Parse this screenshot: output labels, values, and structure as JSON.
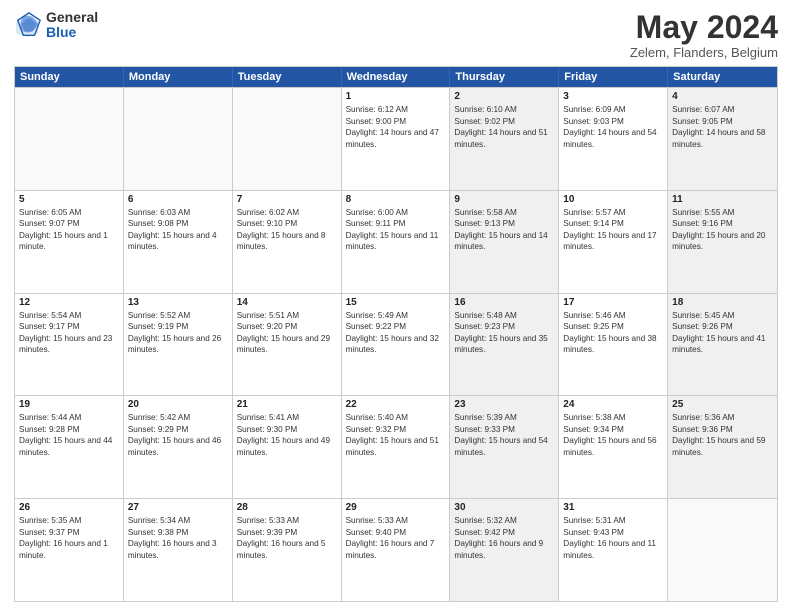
{
  "logo": {
    "general": "General",
    "blue": "Blue"
  },
  "title": "May 2024",
  "subtitle": "Zelem, Flanders, Belgium",
  "days": [
    "Sunday",
    "Monday",
    "Tuesday",
    "Wednesday",
    "Thursday",
    "Friday",
    "Saturday"
  ],
  "weeks": [
    [
      {
        "day": "",
        "sunrise": "",
        "sunset": "",
        "daylight": "",
        "shaded": false,
        "empty": true
      },
      {
        "day": "",
        "sunrise": "",
        "sunset": "",
        "daylight": "",
        "shaded": false,
        "empty": true
      },
      {
        "day": "",
        "sunrise": "",
        "sunset": "",
        "daylight": "",
        "shaded": false,
        "empty": true
      },
      {
        "day": "1",
        "sunrise": "Sunrise: 6:12 AM",
        "sunset": "Sunset: 9:00 PM",
        "daylight": "Daylight: 14 hours and 47 minutes.",
        "shaded": false,
        "empty": false
      },
      {
        "day": "2",
        "sunrise": "Sunrise: 6:10 AM",
        "sunset": "Sunset: 9:02 PM",
        "daylight": "Daylight: 14 hours and 51 minutes.",
        "shaded": true,
        "empty": false
      },
      {
        "day": "3",
        "sunrise": "Sunrise: 6:09 AM",
        "sunset": "Sunset: 9:03 PM",
        "daylight": "Daylight: 14 hours and 54 minutes.",
        "shaded": false,
        "empty": false
      },
      {
        "day": "4",
        "sunrise": "Sunrise: 6:07 AM",
        "sunset": "Sunset: 9:05 PM",
        "daylight": "Daylight: 14 hours and 58 minutes.",
        "shaded": true,
        "empty": false
      }
    ],
    [
      {
        "day": "5",
        "sunrise": "Sunrise: 6:05 AM",
        "sunset": "Sunset: 9:07 PM",
        "daylight": "Daylight: 15 hours and 1 minute.",
        "shaded": false,
        "empty": false
      },
      {
        "day": "6",
        "sunrise": "Sunrise: 6:03 AM",
        "sunset": "Sunset: 9:08 PM",
        "daylight": "Daylight: 15 hours and 4 minutes.",
        "shaded": false,
        "empty": false
      },
      {
        "day": "7",
        "sunrise": "Sunrise: 6:02 AM",
        "sunset": "Sunset: 9:10 PM",
        "daylight": "Daylight: 15 hours and 8 minutes.",
        "shaded": false,
        "empty": false
      },
      {
        "day": "8",
        "sunrise": "Sunrise: 6:00 AM",
        "sunset": "Sunset: 9:11 PM",
        "daylight": "Daylight: 15 hours and 11 minutes.",
        "shaded": false,
        "empty": false
      },
      {
        "day": "9",
        "sunrise": "Sunrise: 5:58 AM",
        "sunset": "Sunset: 9:13 PM",
        "daylight": "Daylight: 15 hours and 14 minutes.",
        "shaded": true,
        "empty": false
      },
      {
        "day": "10",
        "sunrise": "Sunrise: 5:57 AM",
        "sunset": "Sunset: 9:14 PM",
        "daylight": "Daylight: 15 hours and 17 minutes.",
        "shaded": false,
        "empty": false
      },
      {
        "day": "11",
        "sunrise": "Sunrise: 5:55 AM",
        "sunset": "Sunset: 9:16 PM",
        "daylight": "Daylight: 15 hours and 20 minutes.",
        "shaded": true,
        "empty": false
      }
    ],
    [
      {
        "day": "12",
        "sunrise": "Sunrise: 5:54 AM",
        "sunset": "Sunset: 9:17 PM",
        "daylight": "Daylight: 15 hours and 23 minutes.",
        "shaded": false,
        "empty": false
      },
      {
        "day": "13",
        "sunrise": "Sunrise: 5:52 AM",
        "sunset": "Sunset: 9:19 PM",
        "daylight": "Daylight: 15 hours and 26 minutes.",
        "shaded": false,
        "empty": false
      },
      {
        "day": "14",
        "sunrise": "Sunrise: 5:51 AM",
        "sunset": "Sunset: 9:20 PM",
        "daylight": "Daylight: 15 hours and 29 minutes.",
        "shaded": false,
        "empty": false
      },
      {
        "day": "15",
        "sunrise": "Sunrise: 5:49 AM",
        "sunset": "Sunset: 9:22 PM",
        "daylight": "Daylight: 15 hours and 32 minutes.",
        "shaded": false,
        "empty": false
      },
      {
        "day": "16",
        "sunrise": "Sunrise: 5:48 AM",
        "sunset": "Sunset: 9:23 PM",
        "daylight": "Daylight: 15 hours and 35 minutes.",
        "shaded": true,
        "empty": false
      },
      {
        "day": "17",
        "sunrise": "Sunrise: 5:46 AM",
        "sunset": "Sunset: 9:25 PM",
        "daylight": "Daylight: 15 hours and 38 minutes.",
        "shaded": false,
        "empty": false
      },
      {
        "day": "18",
        "sunrise": "Sunrise: 5:45 AM",
        "sunset": "Sunset: 9:26 PM",
        "daylight": "Daylight: 15 hours and 41 minutes.",
        "shaded": true,
        "empty": false
      }
    ],
    [
      {
        "day": "19",
        "sunrise": "Sunrise: 5:44 AM",
        "sunset": "Sunset: 9:28 PM",
        "daylight": "Daylight: 15 hours and 44 minutes.",
        "shaded": false,
        "empty": false
      },
      {
        "day": "20",
        "sunrise": "Sunrise: 5:42 AM",
        "sunset": "Sunset: 9:29 PM",
        "daylight": "Daylight: 15 hours and 46 minutes.",
        "shaded": false,
        "empty": false
      },
      {
        "day": "21",
        "sunrise": "Sunrise: 5:41 AM",
        "sunset": "Sunset: 9:30 PM",
        "daylight": "Daylight: 15 hours and 49 minutes.",
        "shaded": false,
        "empty": false
      },
      {
        "day": "22",
        "sunrise": "Sunrise: 5:40 AM",
        "sunset": "Sunset: 9:32 PM",
        "daylight": "Daylight: 15 hours and 51 minutes.",
        "shaded": false,
        "empty": false
      },
      {
        "day": "23",
        "sunrise": "Sunrise: 5:39 AM",
        "sunset": "Sunset: 9:33 PM",
        "daylight": "Daylight: 15 hours and 54 minutes.",
        "shaded": true,
        "empty": false
      },
      {
        "day": "24",
        "sunrise": "Sunrise: 5:38 AM",
        "sunset": "Sunset: 9:34 PM",
        "daylight": "Daylight: 15 hours and 56 minutes.",
        "shaded": false,
        "empty": false
      },
      {
        "day": "25",
        "sunrise": "Sunrise: 5:36 AM",
        "sunset": "Sunset: 9:36 PM",
        "daylight": "Daylight: 15 hours and 59 minutes.",
        "shaded": true,
        "empty": false
      }
    ],
    [
      {
        "day": "26",
        "sunrise": "Sunrise: 5:35 AM",
        "sunset": "Sunset: 9:37 PM",
        "daylight": "Daylight: 16 hours and 1 minute.",
        "shaded": false,
        "empty": false
      },
      {
        "day": "27",
        "sunrise": "Sunrise: 5:34 AM",
        "sunset": "Sunset: 9:38 PM",
        "daylight": "Daylight: 16 hours and 3 minutes.",
        "shaded": false,
        "empty": false
      },
      {
        "day": "28",
        "sunrise": "Sunrise: 5:33 AM",
        "sunset": "Sunset: 9:39 PM",
        "daylight": "Daylight: 16 hours and 5 minutes.",
        "shaded": false,
        "empty": false
      },
      {
        "day": "29",
        "sunrise": "Sunrise: 5:33 AM",
        "sunset": "Sunset: 9:40 PM",
        "daylight": "Daylight: 16 hours and 7 minutes.",
        "shaded": false,
        "empty": false
      },
      {
        "day": "30",
        "sunrise": "Sunrise: 5:32 AM",
        "sunset": "Sunset: 9:42 PM",
        "daylight": "Daylight: 16 hours and 9 minutes.",
        "shaded": true,
        "empty": false
      },
      {
        "day": "31",
        "sunrise": "Sunrise: 5:31 AM",
        "sunset": "Sunset: 9:43 PM",
        "daylight": "Daylight: 16 hours and 11 minutes.",
        "shaded": false,
        "empty": false
      },
      {
        "day": "",
        "sunrise": "",
        "sunset": "",
        "daylight": "",
        "shaded": true,
        "empty": true
      }
    ]
  ]
}
